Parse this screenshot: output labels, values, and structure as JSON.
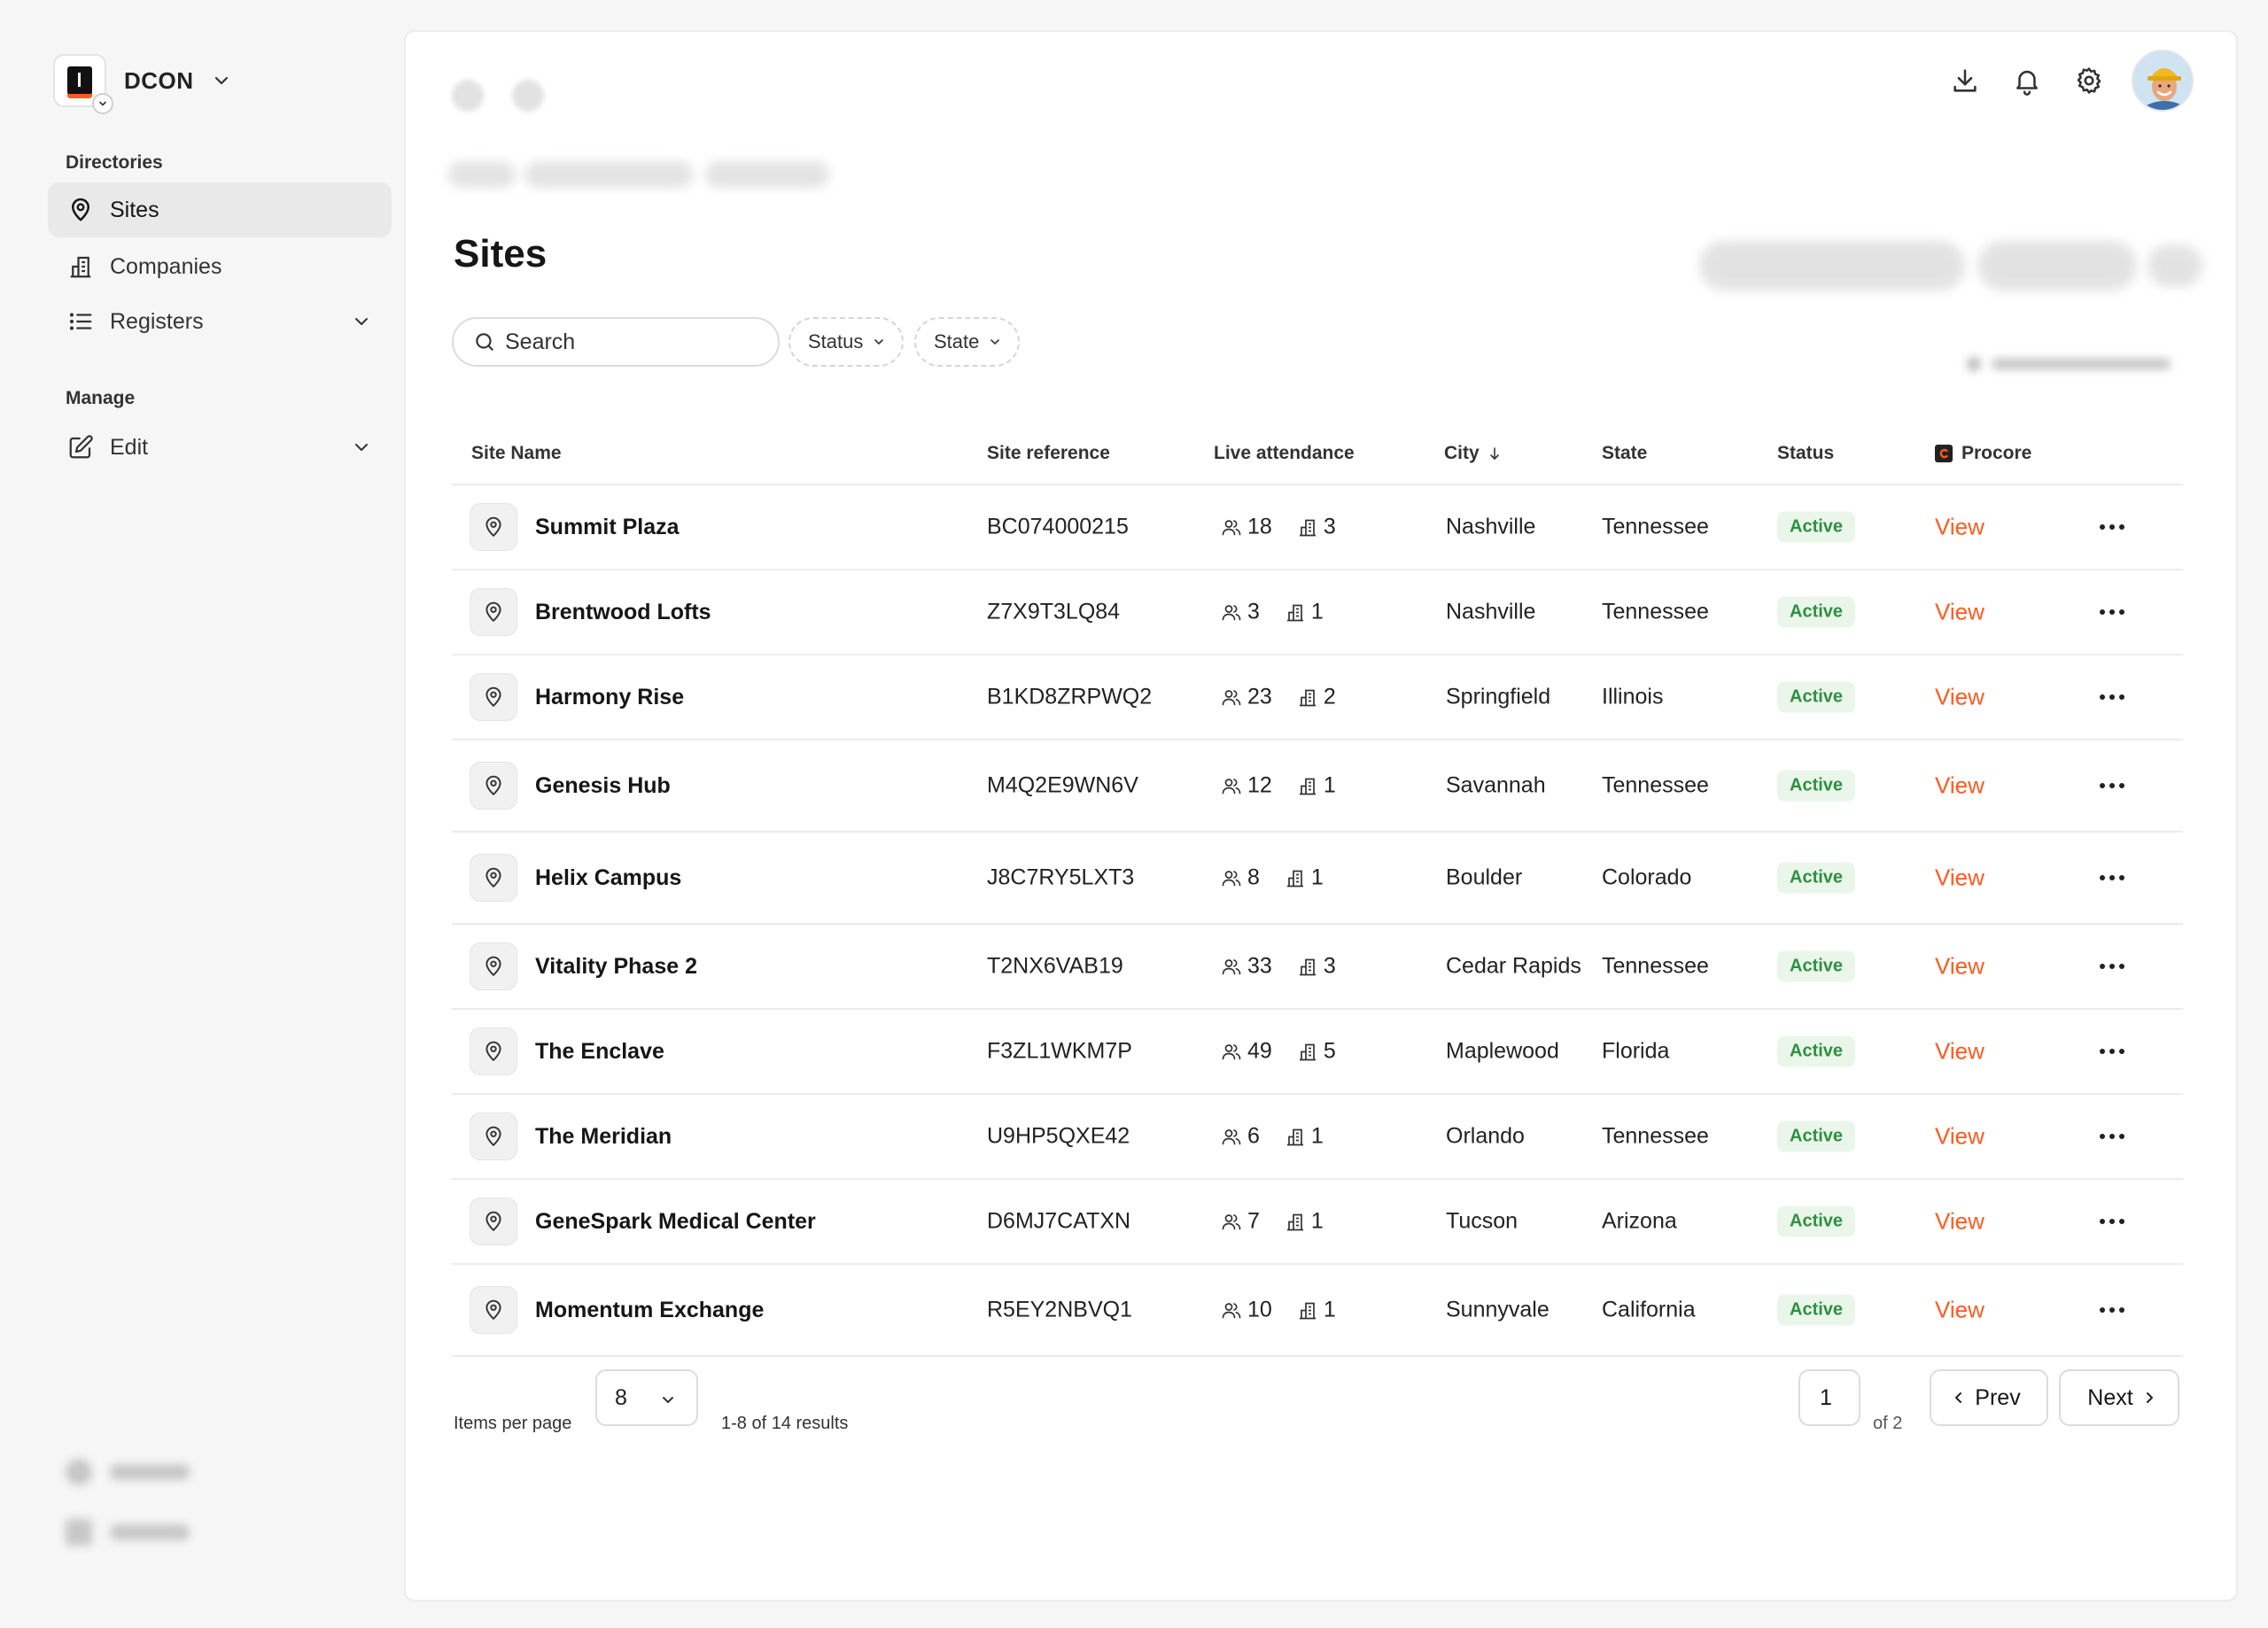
{
  "sidebar": {
    "org_name": "DCON",
    "sections": {
      "directories": "Directories",
      "manage": "Manage"
    },
    "items": {
      "sites": "Sites",
      "companies": "Companies",
      "registers": "Registers",
      "edit": "Edit"
    }
  },
  "header": {
    "title": "Sites"
  },
  "filters": {
    "search_placeholder": "Search",
    "status": "Status",
    "state": "State"
  },
  "table": {
    "columns": {
      "site_name": "Site Name",
      "site_reference": "Site reference",
      "live_attendance": "Live attendance",
      "city": "City",
      "state": "State",
      "status": "Status",
      "procore": "Procore"
    },
    "rows": [
      {
        "name": "Summit Plaza",
        "ref": "BC074000215",
        "people": "18",
        "companies": "3",
        "city": "Nashville",
        "state": "Tennessee",
        "status": "Active",
        "procore": "View"
      },
      {
        "name": "Brentwood Lofts",
        "ref": "Z7X9T3LQ84",
        "people": "3",
        "companies": "1",
        "city": "Nashville",
        "state": "Tennessee",
        "status": "Active",
        "procore": "View"
      },
      {
        "name": "Harmony Rise",
        "ref": "B1KD8ZRPWQ2",
        "people": "23",
        "companies": "2",
        "city": "Springfield",
        "state": "Illinois",
        "status": "Active",
        "procore": "View"
      },
      {
        "name": "Genesis Hub",
        "ref": "M4Q2E9WN6V",
        "people": "12",
        "companies": "1",
        "city": "Savannah",
        "state": "Tennessee",
        "status": "Active",
        "procore": "View"
      },
      {
        "name": "Helix Campus",
        "ref": "J8C7RY5LXT3",
        "people": "8",
        "companies": "1",
        "city": "Boulder",
        "state": "Colorado",
        "status": "Active",
        "procore": "View"
      },
      {
        "name": "Vitality Phase 2",
        "ref": "T2NX6VAB19",
        "people": "33",
        "companies": "3",
        "city": "Cedar Rapids",
        "state": "Tennessee",
        "status": "Active",
        "procore": "View"
      },
      {
        "name": "The Enclave",
        "ref": "F3ZL1WKM7P",
        "people": "49",
        "companies": "5",
        "city": "Maplewood",
        "state": "Florida",
        "status": "Active",
        "procore": "View"
      },
      {
        "name": "The Meridian",
        "ref": "U9HP5QXE42",
        "people": "6",
        "companies": "1",
        "city": "Orlando",
        "state": "Tennessee",
        "status": "Active",
        "procore": "View"
      },
      {
        "name": "GeneSpark Medical Center",
        "ref": "D6MJ7CATXN",
        "people": "7",
        "companies": "1",
        "city": "Tucson",
        "state": "Arizona",
        "status": "Active",
        "procore": "View"
      },
      {
        "name": "Momentum Exchange",
        "ref": "R5EY2NBVQ1",
        "people": "10",
        "companies": "1",
        "city": "Sunnyvale",
        "state": "California",
        "status": "Active",
        "procore": "View"
      }
    ]
  },
  "pagination": {
    "items_per_page_label": "Items per page",
    "items_per_page": "8",
    "results": "1-8 of 14 results",
    "current_page": "1",
    "of_pages": "of 2",
    "prev": "Prev",
    "next": "Next"
  },
  "colors": {
    "accent": "#ff5a1f",
    "active_badge_bg": "#eaf6ea",
    "active_badge_text": "#2f8f41"
  }
}
